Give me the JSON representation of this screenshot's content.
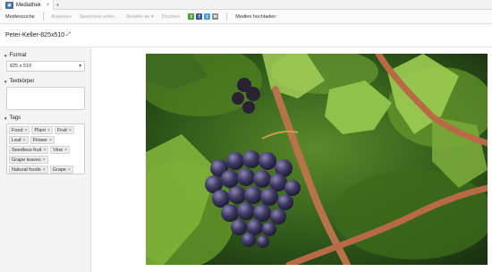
{
  "tabbar": {
    "tab_label": "Mediathek",
    "tab_close": "×",
    "add": "+"
  },
  "toolbar": {
    "mediensuche": "Mediensuche",
    "kopieren": "Kopieren",
    "speichern": "Speichern unter...",
    "senden": "Senden an",
    "drucken": "Drucken",
    "hochladen": "Medien hochladen"
  },
  "title": "Peter-Keller-825x510",
  "left": {
    "format": {
      "heading": "Format",
      "value": "825 x 510"
    },
    "textkoerper": {
      "heading": "Textkörper"
    },
    "tags": {
      "heading": "Tags",
      "items": [
        "Food",
        "Plant",
        "Fruit",
        "Leaf",
        "Flower",
        "Seedless fruit",
        "Vine",
        "Grape leaves",
        "Natural foods",
        "Grape"
      ]
    }
  },
  "colors": {
    "accent": "#3d6ea8",
    "leaf_dark": "#2f5a1a",
    "leaf_light": "#8bbf3a",
    "grape": "#2e2a4a",
    "vine": "#b86a45"
  }
}
